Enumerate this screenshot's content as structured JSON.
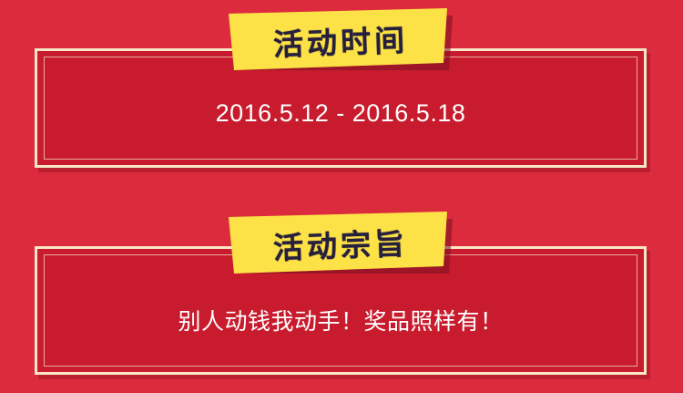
{
  "sections": [
    {
      "title": "活动时间",
      "text": "2016.5.12 - 2016.5.18"
    },
    {
      "title": "活动宗旨",
      "text": "别人动钱我动手！奖品照样有！"
    }
  ],
  "colors": {
    "background": "#dc2b3d",
    "panel": "#c81c2e",
    "panel_border": "#f8e6c7",
    "ribbon_yellow": "#fde247",
    "ribbon_shadow": "#7a1020",
    "title_text": "#27203c",
    "body_text": "#ffffff"
  }
}
